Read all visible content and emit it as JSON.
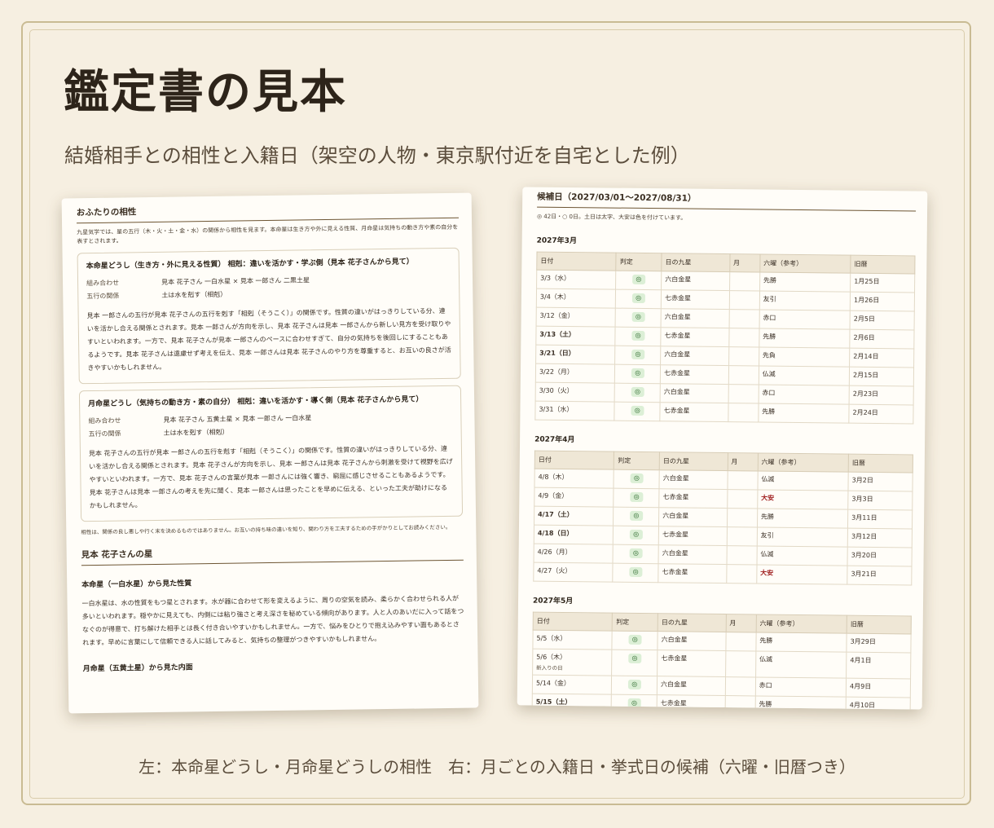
{
  "title": "鑑定書の見本",
  "subtitle": "結婚相手との相性と入籍日（架空の人物・東京駅付近を自宅とした例）",
  "caption": "左：本命星どうし・月命星どうしの相性　右：月ごとの入籍日・挙式日の候補（六曜・旧暦つき）",
  "left": {
    "section_title": "おふたりの相性",
    "intro": "九星気学では、星の五行（木・火・土・金・水）の関係から相性を見ます。本命星は生き方や外に見える性質、月命星は気持ちの動き方や素の自分を表すとされます。",
    "cards": [
      {
        "heading": "本命星どうし（生き方・外に見える性質） 相剋：違いを活かす・学ぶ側（見本 花子さんから見て）",
        "rows": [
          {
            "k": "組み合わせ",
            "v": "見本 花子さん 一白水星 × 見本 一郎さん 二黒土星"
          },
          {
            "k": "五行の関係",
            "v": "土は水を剋す（相剋）"
          }
        ],
        "body": "見本 一郎さんの五行が見本 花子さんの五行を剋す「相剋（そうこく）」の関係です。性質の違いがはっきりしている分、違いを活かし合える関係とされます。見本 一郎さんが方向を示し、見本 花子さんは見本 一郎さんから新しい見方を受け取りやすいといわれます。一方で、見本 花子さんが見本 一郎さんのペースに合わせすぎて、自分の気持ちを後回しにすることもあるようです。見本 花子さんは遠慮せず考えを伝え、見本 一郎さんは見本 花子さんのやり方を尊重すると、お互いの良さが活きやすいかもしれません。"
      },
      {
        "heading": "月命星どうし（気持ちの動き方・素の自分） 相剋：違いを活かす・導く側（見本 花子さんから見て）",
        "rows": [
          {
            "k": "組み合わせ",
            "v": "見本 花子さん 五黄土星 × 見本 一郎さん 一白水星"
          },
          {
            "k": "五行の関係",
            "v": "土は水を剋す（相剋）"
          }
        ],
        "body": "見本 花子さんの五行が見本 一郎さんの五行を剋す「相剋（そうこく）」の関係です。性質の違いがはっきりしている分、違いを活かし合える関係とされます。見本 花子さんが方向を示し、見本 一郎さんは見本 花子さんから刺激を受けて視野を広げやすいといわれます。一方で、見本 花子さんの言葉が見本 一郎さんには強く響き、窮屈に感じさせることもあるようです。見本 花子さんは見本 一郎さんの考えを先に聞く、見本 一郎さんは思ったことを早めに伝える、といった工夫が助けになるかもしれません。"
      }
    ],
    "note": "相性は、関係の良し悪しや行く末を決めるものではありません。お互いの持ち味の違いを知り、関わり方を工夫するための手がかりとしてお読みください。",
    "star_section_title": "見本 花子さんの星",
    "honmei_h": "本命星（一白水星）から見た性質",
    "honmei_body": "一白水星は、水の性質をもつ星とされます。水が器に合わせて形を変えるように、周りの空気を読み、柔らかく合わせられる人が多いといわれます。穏やかに見えても、内側には粘り強さと考え深さを秘めている傾向があります。人と人のあいだに入って話をつなぐのが得意で、打ち解けた相手とは長く付き合いやすいかもしれません。一方で、悩みをひとりで抱え込みやすい面もあるとされます。早めに言葉にして信頼できる人に話してみると、気持ちの整理がつきやすいかもしれません。",
    "getsumei_h": "月命星（五黄土星）から見た内面"
  },
  "right": {
    "section_title": "候補日（2027/03/01〜2027/08/31）",
    "legend": "◎ 42日・○ 0日。土日は太字、大安は色を付けています。",
    "headers": [
      "日付",
      "判定",
      "日の九星",
      "月",
      "六曜（参考）",
      "旧暦"
    ],
    "months": [
      {
        "label": "2027年3月",
        "rows": [
          {
            "date": "3/3（水）",
            "mark": "◎",
            "star": "六白金星",
            "m": "",
            "rokuyo": "先勝",
            "kyureki": "1月25日",
            "bold": false,
            "taian": false,
            "note": ""
          },
          {
            "date": "3/4（木）",
            "mark": "◎",
            "star": "七赤金星",
            "m": "",
            "rokuyo": "友引",
            "kyureki": "1月26日",
            "bold": false,
            "taian": false,
            "note": ""
          },
          {
            "date": "3/12（金）",
            "mark": "◎",
            "star": "六白金星",
            "m": "",
            "rokuyo": "赤口",
            "kyureki": "2月5日",
            "bold": false,
            "taian": false,
            "note": ""
          },
          {
            "date": "3/13（土）",
            "mark": "◎",
            "star": "七赤金星",
            "m": "",
            "rokuyo": "先勝",
            "kyureki": "2月6日",
            "bold": true,
            "taian": false,
            "note": ""
          },
          {
            "date": "3/21（日）",
            "mark": "◎",
            "star": "六白金星",
            "m": "",
            "rokuyo": "先負",
            "kyureki": "2月14日",
            "bold": true,
            "taian": false,
            "note": ""
          },
          {
            "date": "3/22（月）",
            "mark": "◎",
            "star": "七赤金星",
            "m": "",
            "rokuyo": "仏滅",
            "kyureki": "2月15日",
            "bold": false,
            "taian": false,
            "note": ""
          },
          {
            "date": "3/30（火）",
            "mark": "◎",
            "star": "六白金星",
            "m": "",
            "rokuyo": "赤口",
            "kyureki": "2月23日",
            "bold": false,
            "taian": false,
            "note": ""
          },
          {
            "date": "3/31（水）",
            "mark": "◎",
            "star": "七赤金星",
            "m": "",
            "rokuyo": "先勝",
            "kyureki": "2月24日",
            "bold": false,
            "taian": false,
            "note": ""
          }
        ]
      },
      {
        "label": "2027年4月",
        "rows": [
          {
            "date": "4/8（木）",
            "mark": "◎",
            "star": "六白金星",
            "m": "",
            "rokuyo": "仏滅",
            "kyureki": "3月2日",
            "bold": false,
            "taian": false,
            "note": ""
          },
          {
            "date": "4/9（金）",
            "mark": "◎",
            "star": "七赤金星",
            "m": "",
            "rokuyo": "大安",
            "kyureki": "3月3日",
            "bold": false,
            "taian": true,
            "note": ""
          },
          {
            "date": "4/17（土）",
            "mark": "◎",
            "star": "六白金星",
            "m": "",
            "rokuyo": "先勝",
            "kyureki": "3月11日",
            "bold": true,
            "taian": false,
            "note": ""
          },
          {
            "date": "4/18（日）",
            "mark": "◎",
            "star": "七赤金星",
            "m": "",
            "rokuyo": "友引",
            "kyureki": "3月12日",
            "bold": true,
            "taian": false,
            "note": ""
          },
          {
            "date": "4/26（月）",
            "mark": "◎",
            "star": "六白金星",
            "m": "",
            "rokuyo": "仏滅",
            "kyureki": "3月20日",
            "bold": false,
            "taian": false,
            "note": ""
          },
          {
            "date": "4/27（火）",
            "mark": "◎",
            "star": "七赤金星",
            "m": "",
            "rokuyo": "大安",
            "kyureki": "3月21日",
            "bold": false,
            "taian": true,
            "note": ""
          }
        ]
      },
      {
        "label": "2027年5月",
        "rows": [
          {
            "date": "5/5（水）",
            "mark": "◎",
            "star": "六白金星",
            "m": "",
            "rokuyo": "先勝",
            "kyureki": "3月29日",
            "bold": false,
            "taian": false,
            "note": ""
          },
          {
            "date": "5/6（木）",
            "mark": "◎",
            "star": "七赤金星",
            "m": "",
            "rokuyo": "仏滅",
            "kyureki": "4月1日",
            "bold": false,
            "taian": false,
            "note": "新入りの日"
          },
          {
            "date": "5/14（金）",
            "mark": "◎",
            "star": "六白金星",
            "m": "",
            "rokuyo": "赤口",
            "kyureki": "4月9日",
            "bold": false,
            "taian": false,
            "note": ""
          },
          {
            "date": "5/15（土）",
            "mark": "◎",
            "star": "七赤金星",
            "m": "",
            "rokuyo": "先勝",
            "kyureki": "4月10日",
            "bold": true,
            "taian": false,
            "note": ""
          }
        ]
      }
    ]
  }
}
